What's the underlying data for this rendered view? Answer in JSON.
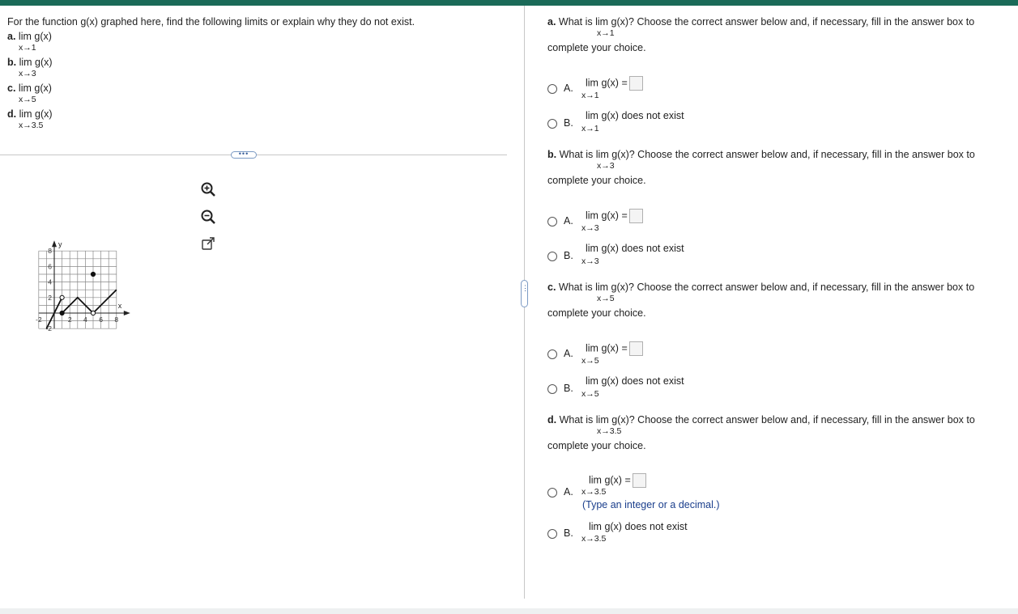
{
  "left": {
    "intro": "For the function g(x) graphed here, find the following limits or explain why they do not exist.",
    "items": [
      {
        "letter": "a.",
        "expr": "lim g(x)",
        "sub": "x→1"
      },
      {
        "letter": "b.",
        "expr": "lim g(x)",
        "sub": "x→3"
      },
      {
        "letter": "c.",
        "expr": "lim g(x)",
        "sub": "x→5"
      },
      {
        "letter": "d.",
        "expr": "lim  g(x)",
        "sub": "x→3.5"
      }
    ],
    "more_button": "•••",
    "tools": [
      "zoom-in-icon",
      "zoom-out-icon",
      "external-link-icon"
    ]
  },
  "graph": {
    "x_axis_label": "x",
    "y_axis_label": "y",
    "x_ticks": [
      "-2",
      "2",
      "4",
      "6",
      "8"
    ],
    "y_ticks": [
      "8",
      "6",
      "4",
      "2",
      "-2"
    ],
    "line_color": "#111111"
  },
  "chart_data": {
    "type": "line",
    "xlim": [
      -2,
      8
    ],
    "ylim": [
      -2,
      8
    ],
    "grid": true,
    "series": [
      {
        "x": [
          -1,
          0,
          1
        ],
        "y": [
          -2,
          0,
          2
        ],
        "end": "open"
      },
      {
        "x": [
          1,
          3,
          5,
          8
        ],
        "y": [
          0,
          2,
          0,
          3
        ],
        "start": "closed",
        "mid_open_at": [
          5,
          0
        ]
      }
    ],
    "points": [
      {
        "x": 1,
        "y": 2,
        "style": "open"
      },
      {
        "x": 1,
        "y": 0,
        "style": "closed"
      },
      {
        "x": 5,
        "y": 0,
        "style": "open"
      },
      {
        "x": 5,
        "y": 5,
        "style": "closed"
      }
    ]
  },
  "questions": [
    {
      "letter": "a.",
      "text_pre": "What is",
      "text_lim": "lim g(x)?",
      "text_post": "Choose the correct answer below and, if necessary, fill in the answer box to",
      "sub": "x→1",
      "complete": "complete your choice.",
      "option_a": {
        "letter": "A.",
        "lim": "lim g(x) =",
        "sub": "x→1"
      },
      "option_b": {
        "letter": "B.",
        "lim": "lim g(x) does not exist",
        "sub": "x→1"
      }
    },
    {
      "letter": "b.",
      "text_pre": "What is",
      "text_lim": "lim g(x)?",
      "text_post": "Choose the correct answer below and, if necessary, fill in the answer box to",
      "sub": "x→3",
      "complete": "complete your choice.",
      "option_a": {
        "letter": "A.",
        "lim": "lim g(x) =",
        "sub": "x→3"
      },
      "option_b": {
        "letter": "B.",
        "lim": "lim g(x) does not exist",
        "sub": "x→3"
      }
    },
    {
      "letter": "c.",
      "text_pre": "What is",
      "text_lim": "lim g(x)?",
      "text_post": "Choose the correct answer below and, if necessary, fill in the answer box to",
      "sub": "x→5",
      "complete": "complete your choice.",
      "option_a": {
        "letter": "A.",
        "lim": "lim g(x) =",
        "sub": "x→5"
      },
      "option_b": {
        "letter": "B.",
        "lim": "lim g(x) does not exist",
        "sub": "x→5"
      }
    },
    {
      "letter": "d.",
      "text_pre": "What is",
      "text_lim": "lim  g(x)?",
      "text_post": "Choose the correct answer below and, if necessary, fill in the answer box to",
      "sub": "x→3.5",
      "complete": "complete your choice.",
      "option_a": {
        "letter": "A.",
        "lim": "lim  g(x) =",
        "sub": "x→3.5",
        "hint": "(Type an integer or a decimal.)"
      },
      "option_b": {
        "letter": "B.",
        "lim": "lim  g(x) does not exist",
        "sub": "x→3.5"
      }
    }
  ],
  "splitter_handle": "•\n•\n•",
  "colors": {
    "topbar": "#1a6a58",
    "hint": "#1a3e8c",
    "grid": "#888888"
  }
}
